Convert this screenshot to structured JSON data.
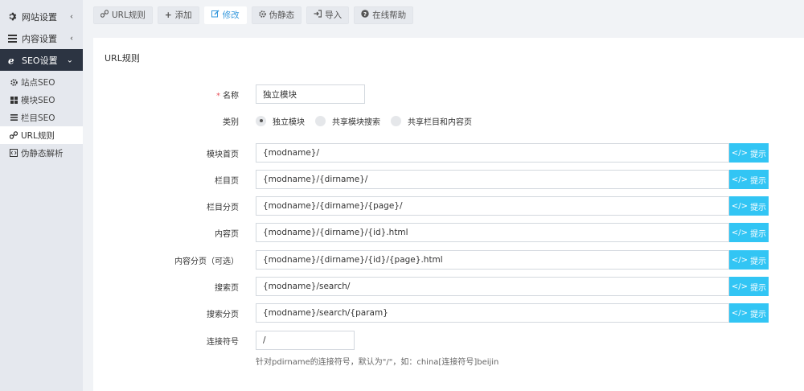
{
  "sidebar": {
    "groups": [
      {
        "label": "网站设置",
        "icon": "gear-icon"
      },
      {
        "label": "内容设置",
        "icon": "list-icon"
      },
      {
        "label": "SEO设置",
        "icon": "ie-icon"
      }
    ],
    "sub_items": [
      {
        "label": "站点SEO",
        "icon": "gear-icon"
      },
      {
        "label": "模块SEO",
        "icon": "grid-icon"
      },
      {
        "label": "栏目SEO",
        "icon": "list-icon"
      },
      {
        "label": "URL规则",
        "icon": "link-icon"
      },
      {
        "label": "伪静态解析",
        "icon": "code-icon"
      }
    ]
  },
  "toolbar": {
    "items": [
      {
        "label": "URL规则",
        "icon": "link-icon"
      },
      {
        "label": "添加",
        "icon": "plus-icon"
      },
      {
        "label": "修改",
        "icon": "edit-icon"
      },
      {
        "label": "伪静态",
        "icon": "gear-icon"
      },
      {
        "label": "导入",
        "icon": "import-icon"
      },
      {
        "label": "在线帮助",
        "icon": "help-icon"
      }
    ]
  },
  "panel": {
    "title": "URL规则",
    "required_mark": "*",
    "name_label": "名称",
    "name_value": "独立模块",
    "type_label": "类别",
    "type_options": [
      "独立模块",
      "共享模块搜索",
      "共享栏目和内容页"
    ],
    "hint_label": "提示",
    "rules": [
      {
        "label": "模块首页",
        "value": "{modname}/"
      },
      {
        "label": "栏目页",
        "value": "{modname}/{dirname}/"
      },
      {
        "label": "栏目分页",
        "value": "{modname}/{dirname}/{page}/"
      },
      {
        "label": "内容页",
        "value": "{modname}/{dirname}/{id}.html"
      },
      {
        "label": "内容分页（可选）",
        "value": "{modname}/{dirname}/{id}/{page}.html"
      },
      {
        "label": "搜索页",
        "value": "{modname}/search/"
      },
      {
        "label": "搜索分页",
        "value": "{modname}/search/{param}"
      }
    ],
    "separator_label": "连接符号",
    "separator_value": "/",
    "separator_help": "针对pdirname的连接符号，默认为\"/\"，如：china[连接符号]beijin"
  }
}
